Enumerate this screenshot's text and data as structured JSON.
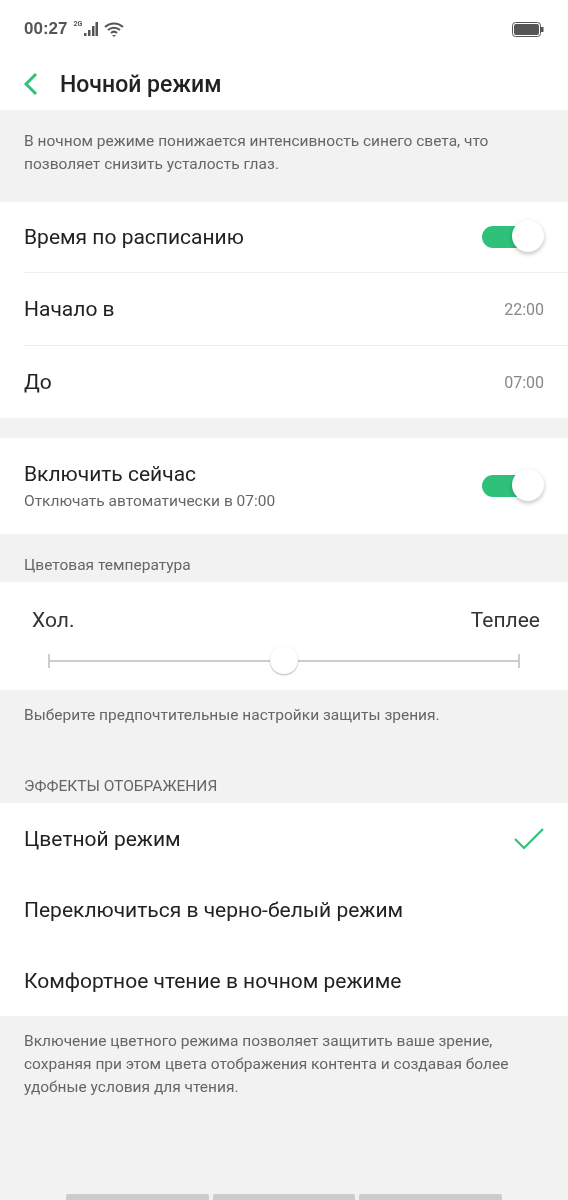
{
  "status_bar": {
    "time": "00:27",
    "network": "2G"
  },
  "header": {
    "title": "Ночной режим"
  },
  "description": "В ночном режиме понижается интенсивность синего света, что позволяет снизить усталость глаз.",
  "schedule": [
    {
      "kind": "toggle",
      "label": "Время по расписанию",
      "on": true
    },
    {
      "kind": "value",
      "label": "Начало в",
      "value": "22:00"
    },
    {
      "kind": "value",
      "label": "До",
      "value": "07:00"
    }
  ],
  "enable_now": {
    "label": "Включить сейчас",
    "sublabel": "Отключать автоматически в 07:00",
    "on": true
  },
  "color_temperature": {
    "heading": "Цветовая температура",
    "min_label": "Хол.",
    "max_label": "Теплее",
    "level": 0.5,
    "note": "Выберите предпочтительные настройки защиты зрения."
  },
  "display_effects": {
    "heading": "ЭФФЕКТЫ ОТОБРАЖЕНИЯ",
    "options": [
      {
        "label": "Цветной режим",
        "selected": true
      },
      {
        "label": "Переключиться в черно-белый режим",
        "selected": false
      },
      {
        "label": "Комфортное чтение в ночном режиме",
        "selected": false
      }
    ],
    "note": "Включение цветного режима позволяет защитить ваше зрение, сохраняя при этом цвета отображения контента и создавая более удобные условия для чтения."
  }
}
